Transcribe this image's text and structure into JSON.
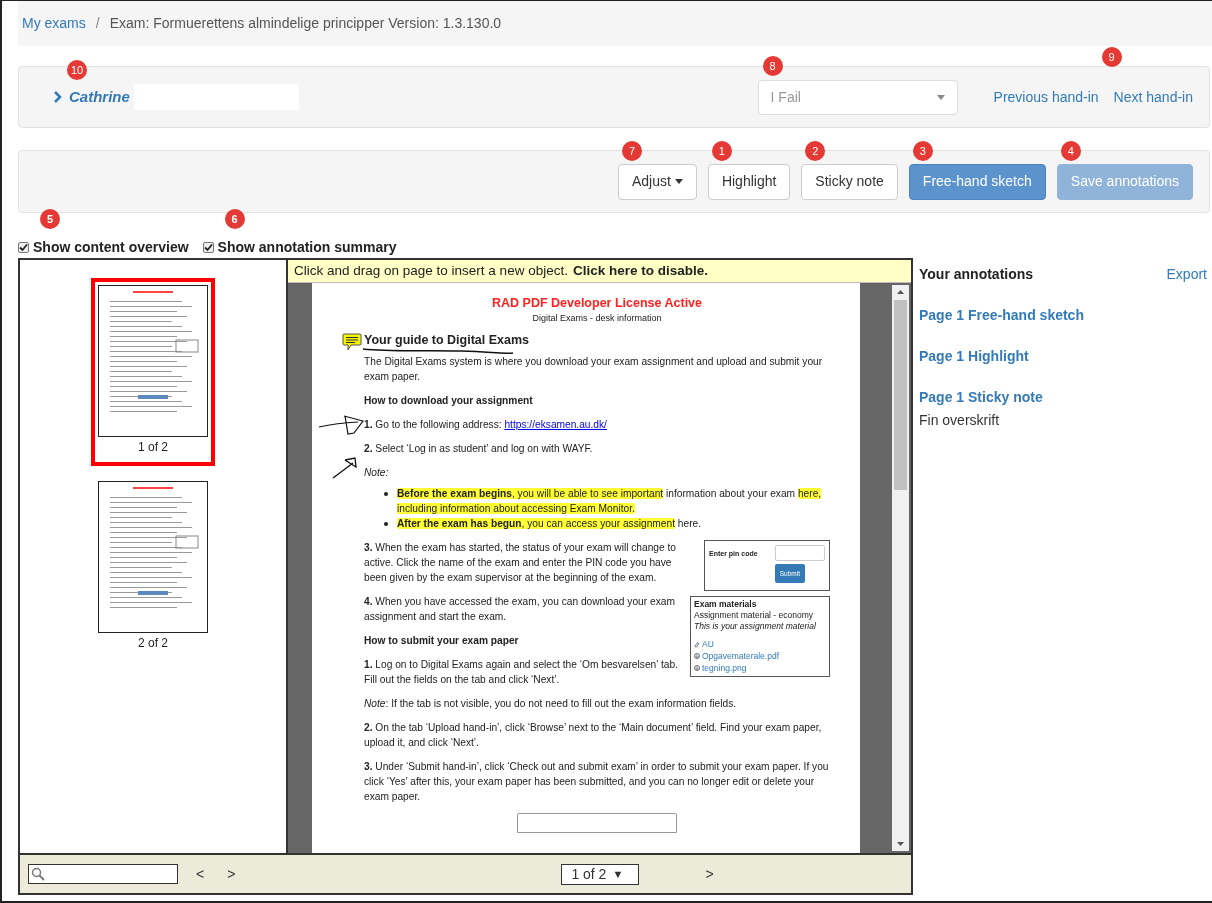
{
  "breadcrumb_separator": "/",
  "breadcrumb": [
    {
      "label": "My exams",
      "kind": "link"
    },
    {
      "label": "Exam: Formuerettens almindelige principper Version: 1.3.130.0",
      "kind": "current"
    }
  ],
  "student": {
    "name": "Cathrine",
    "badge": "10"
  },
  "grade_select": {
    "value": "I Fail",
    "badge": "8"
  },
  "hand_in_nav": {
    "badge": "9",
    "links": [
      {
        "label": "Previous hand-in"
      },
      {
        "label": "Next hand-in"
      }
    ]
  },
  "toolbar": [
    {
      "label": "Adjust",
      "kind": "dropdown",
      "badge": "7",
      "disabled": false
    },
    {
      "label": "Highlight",
      "kind": "default",
      "badge": "1",
      "disabled": false
    },
    {
      "label": "Sticky note",
      "kind": "default",
      "badge": "2",
      "disabled": false
    },
    {
      "label": "Free-hand sketch",
      "kind": "primary",
      "badge": "3",
      "disabled": false
    },
    {
      "label": "Save annotations",
      "kind": "primary",
      "badge": "4",
      "disabled": true
    }
  ],
  "options": [
    {
      "label": "Show content overview",
      "checked": true,
      "badge": "5"
    },
    {
      "label": "Show annotation summary",
      "checked": true,
      "badge": "6"
    }
  ],
  "viewer": {
    "notice": "Click and drag on page to insert a new object.",
    "notice_link": "Click here to disable.",
    "thumbnails": [
      {
        "label": "1 of 2",
        "selected": true
      },
      {
        "label": "2 of 2",
        "selected": false
      }
    ],
    "document": [
      {
        "kind": "license",
        "text": "RAD PDF Developer License Active"
      },
      {
        "kind": "caption",
        "text": "Digital Exams - desk information"
      },
      {
        "kind": "title",
        "text": "Your guide to Digital Exams",
        "sticky_note": true,
        "sketch": true
      },
      {
        "kind": "paragraph",
        "text": "The Digital Exams system is where you download your exam assignment and upload and submit your exam paper."
      },
      {
        "kind": "heading",
        "text": "How to download your assignment"
      },
      {
        "kind": "paragraph",
        "text": "**1.** Go to the following address: ",
        "link": "https://eksamen.au.dk/",
        "sketch": true
      },
      {
        "kind": "paragraph",
        "text": "**2.** Select ‘Log in as student’ and log on with WAYF."
      },
      {
        "kind": "note",
        "text": "Note:",
        "sketch": true
      },
      {
        "kind": "bullets",
        "items": [
          {
            "segments": [
              {
                "text": "**Before the exam begins**, you will be able to see important",
                "highlight": true
              },
              {
                "text": " information about your exam ",
                "highlight": false
              },
              {
                "text": "here, including information about accessing Exam Monitor.",
                "highlight": true
              }
            ]
          },
          {
            "segments": [
              {
                "text": "**After the exam has begun**, you can access your assignment",
                "highlight": true
              },
              {
                "text": " here.",
                "highlight": false
              }
            ]
          }
        ]
      },
      {
        "kind": "figure_row",
        "blocks": [
          {
            "kind": "paragraph",
            "text": "**3.** When the exam has started, the status of your exam will change to active. Click the name of the exam and enter the PIN code you have been given by the exam supervisor at the beginning of the exam."
          }
        ],
        "figure": {
          "kind": "pin",
          "label": "Enter pin code",
          "button": "Submit"
        }
      },
      {
        "kind": "figure_row",
        "blocks": [
          {
            "kind": "paragraph",
            "text": "**4.** When you have accessed the exam, you can download your exam assignment and start the exam."
          },
          {
            "kind": "heading",
            "text": "How to submit your exam paper"
          },
          {
            "kind": "paragraph",
            "text": "**1.** Log on to Digital Exams again and select the ‘Om besvarelsen’ tab. Fill out the fields on the tab and click ‘Next’."
          }
        ],
        "figure": {
          "kind": "materials",
          "title": "Exam materials",
          "lines": [
            {
              "text": "Assignment material - economy",
              "italic": false
            },
            {
              "text": "This is your assignment material",
              "italic": true
            }
          ],
          "links": [
            {
              "label": "AU"
            },
            {
              "label": "Opgavematerale.pdf"
            },
            {
              "label": "tegning.png"
            }
          ]
        }
      },
      {
        "kind": "paragraph",
        "text": "*Note*: If the tab is not visible, you do not need to fill out the exam information fields."
      },
      {
        "kind": "paragraph",
        "text": "**2.** On the tab ‘Upload hand-in’, click ‘Browse’ next to the ‘Main document’ field. Find your exam paper, upload it, and click ‘Next’."
      },
      {
        "kind": "paragraph",
        "text": "**3.** Under ‘Submit hand-in’, click ‘Check out and submit exam’ in order to submit your exam paper. If you click ‘Yes’ after this, your exam paper has been submitted, and you can no longer edit or delete your exam paper."
      },
      {
        "kind": "image"
      }
    ],
    "pager": {
      "prev": "<",
      "next": ">",
      "page": "1 of 2",
      "caret": "▼",
      "next_page": ">"
    }
  },
  "annotations": {
    "title": "Your annotations",
    "export": "Export",
    "items": [
      {
        "label": "Page 1 Free-hand sketch"
      },
      {
        "label": "Page 1 Highlight"
      },
      {
        "label": "Page 1 Sticky note",
        "note": "Fin overskrift"
      }
    ]
  }
}
